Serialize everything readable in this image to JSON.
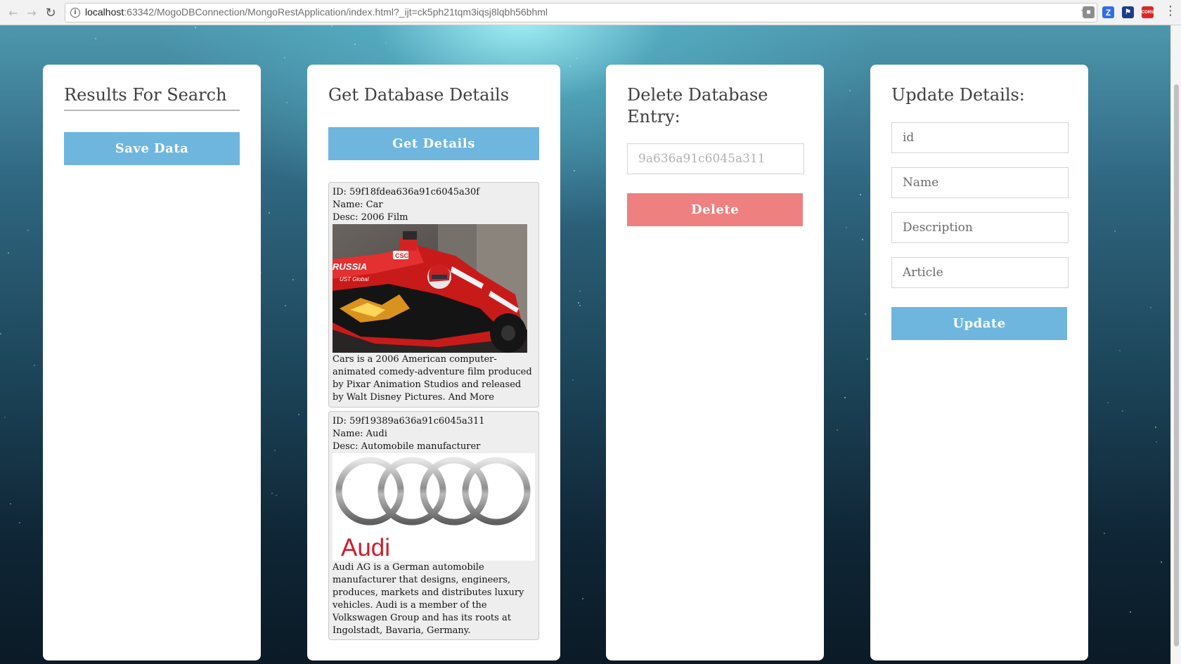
{
  "browser": {
    "url_host": "localhost",
    "url_path": ":63342/MogoDBConnection/MongoRestApplication/index.html?_ijt=ck5ph21tqm3iqsj8lqbh56bhml",
    "extensions": [
      "Z",
      "CORS"
    ]
  },
  "panels": {
    "search": {
      "title": "Results For Search",
      "save_label": "Save Data"
    },
    "details": {
      "title": "Get Database Details",
      "get_label": "Get Details",
      "results": [
        {
          "id": "ID: 59f18fdea636a91c6045a30f",
          "name": "Name: Car",
          "desc": "Desc: 2006 Film",
          "article": "Cars is a 2006 American computer-animated comedy-adventure film produced by Pixar Animation Studios and released by Walt Disney Pictures. And More",
          "image": {
            "car_text": "RUSSIA",
            "team_text": "UST Global",
            "sponsor_text": "CSC"
          }
        },
        {
          "id": "ID: 59f19389a636a91c6045a311",
          "name": "Name: Audi",
          "desc": "Desc: Automobile manufacturer",
          "article": "Audi AG is a German automobile manufacturer that designs, engineers, produces, markets and distributes luxury vehicles. Audi is a member of the Volkswagen Group and has its roots at Ingolstadt, Bavaria, Germany.",
          "image": {
            "logo_text": "Audi"
          }
        }
      ]
    },
    "delete": {
      "title_line1": "Delete Database",
      "title_line2": "Entry:",
      "input_placeholder": "9a636a91c6045a311",
      "delete_label": "Delete"
    },
    "update": {
      "title": "Update Details:",
      "id_placeholder": "id",
      "name_placeholder": "Name",
      "description_placeholder": "Description",
      "article_placeholder": "Article",
      "update_label": "Update"
    }
  },
  "colors": {
    "primary_button": "#6fb6de",
    "danger_button": "#ee8080",
    "panel_background": "#ffffff",
    "page_background": "#1c4458"
  }
}
